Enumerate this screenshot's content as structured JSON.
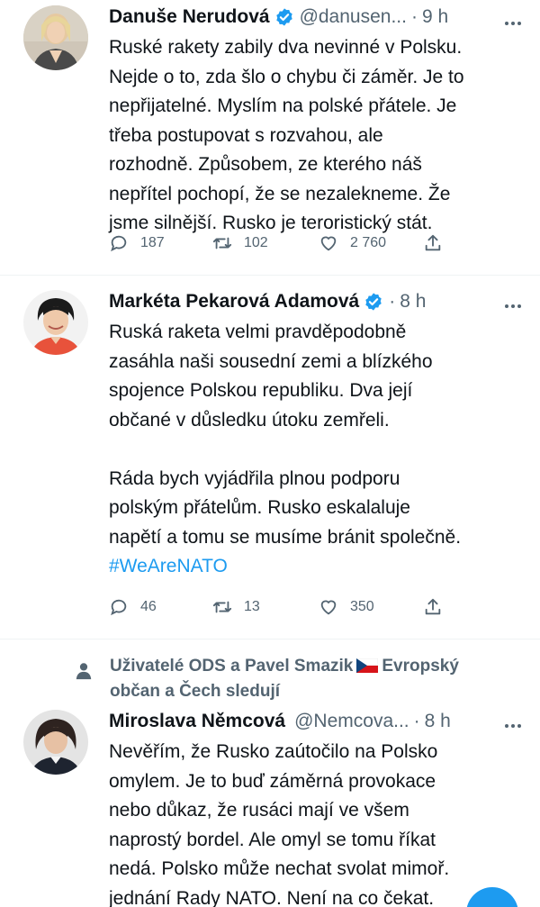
{
  "tweets": [
    {
      "name": "Danuše Nerudová",
      "handle": "@danusen...",
      "dot": "·",
      "time": "9 h",
      "text": "Ruské rakety zabily dva nevinné v Polsku.\nNejde o to, zda šlo o chybu či záměr. Je to\nnepřijatelné. Myslím na polské přátele. Je\ntřeba postupovat s rozvahou, ale\nrozhodně. Způsobem, ze kterého náš\nnepřítel pochopí, že se nezalekneme. Že\njsme silnější. Rusko je teroristický stát.",
      "hashtag": "",
      "replies": "187",
      "retweets": "102",
      "likes": "2 760"
    },
    {
      "name": "Markéta Pekarová Adamová",
      "handle": "",
      "dot": "·",
      "time": "8 h",
      "text": "Ruská raketa velmi pravděpodobně\nzasáhla naši sousední zemi a blízkého\nspojence Polskou republiku. Dva její\nobčané v důsledku útoku zemřeli.\n\nRáda bych vyjádřila plnou podporu\npolským přátelům. Rusko eskalaluje\nnapětí a tomu se musíme bránit společně.\n",
      "hashtag": "#WeAreNATO",
      "replies": "46",
      "retweets": "13",
      "likes": "350"
    },
    {
      "social_context_a": "Uživatelé ODS a Pavel Smazik",
      "social_context_b": "Evropský občan a Čech sledují",
      "name": "Miroslava Němcová",
      "handle": "@Nemcova...",
      "dot": "·",
      "time": "8 h",
      "text": "Nevěřím, že Rusko zaútočilo na Polsko\nomylem. Je to buď záměrná provokace\nnebo důkaz, že rusáci mají ve všem\nnaprostý bordel. Ale omyl se tomu říkat\nnedá. Polsko může nechat svolat mimoř.\njednání Rady NATO. Není na co čekat."
    }
  ],
  "icons": {
    "verified": "verified-badge-icon",
    "more": "more-options-icon",
    "reply": "reply-icon",
    "retweet": "retweet-icon",
    "like": "like-icon",
    "share": "share-icon",
    "social": "person-icon",
    "flag": "czech-flag-icon"
  },
  "colors": {
    "accent": "#1d9bf0",
    "secondary_text": "#536471",
    "primary_text": "#0f1419",
    "divider": "#eff3f4"
  }
}
